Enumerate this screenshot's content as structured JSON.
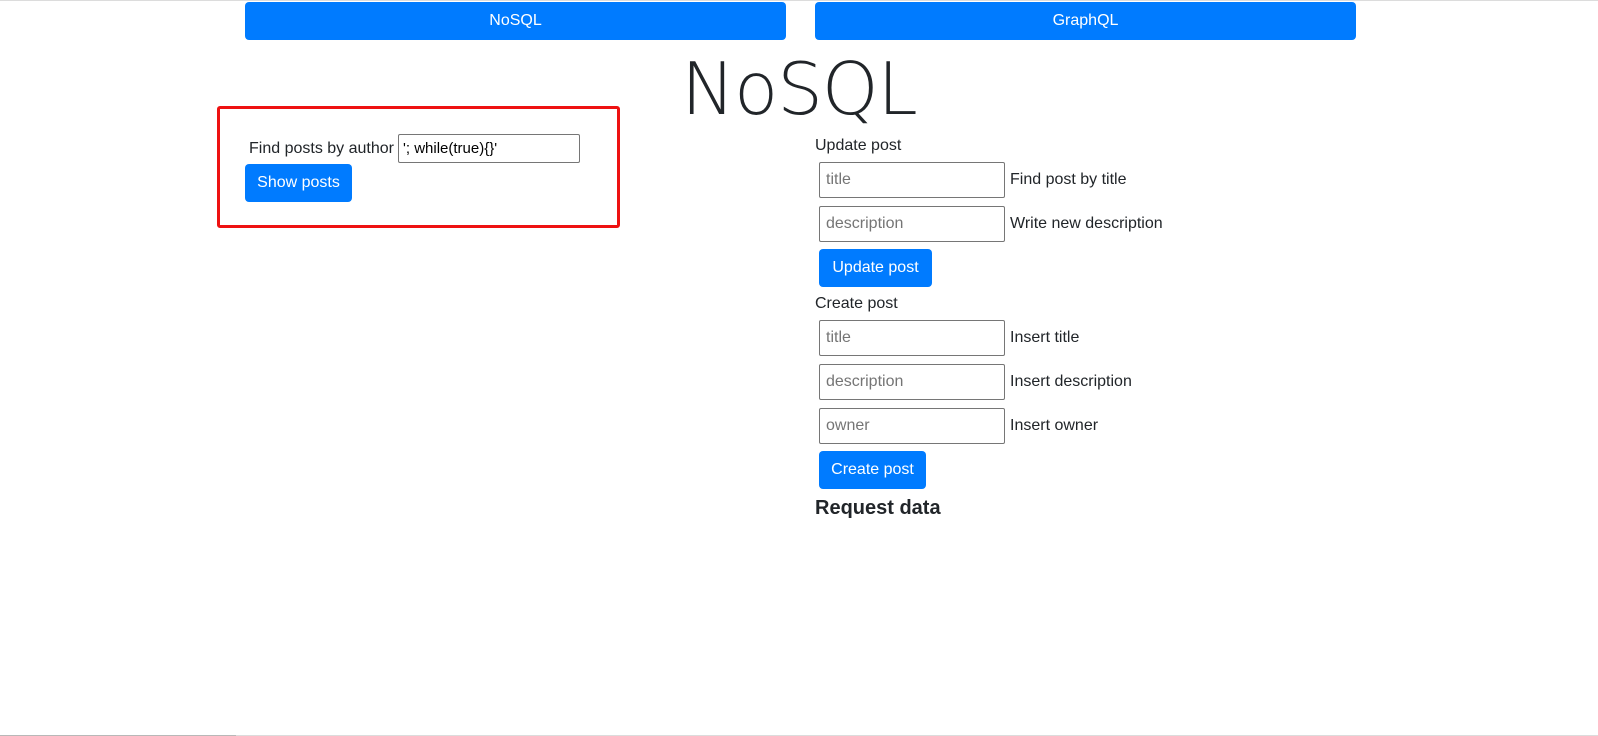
{
  "nav": {
    "nosql_label": "NoSQL",
    "graphql_label": "GraphQL"
  },
  "page_title": "NoSQL",
  "search": {
    "label": "Find posts by author",
    "value": "'; while(true){}'",
    "button_label": "Show posts"
  },
  "update_post": {
    "heading": "Update post",
    "title_placeholder": "title",
    "title_hint": "Find post by title",
    "description_placeholder": "description",
    "description_hint": "Write new description",
    "button_label": "Update post"
  },
  "create_post": {
    "heading": "Create post",
    "title_placeholder": "title",
    "title_hint": "Insert title",
    "description_placeholder": "description",
    "description_hint": "Insert description",
    "owner_placeholder": "owner",
    "owner_hint": "Insert owner",
    "button_label": "Create post"
  },
  "request_data_heading": "Request data",
  "colors": {
    "primary": "#007bff",
    "highlight": "#ee1111",
    "text": "#212529"
  }
}
